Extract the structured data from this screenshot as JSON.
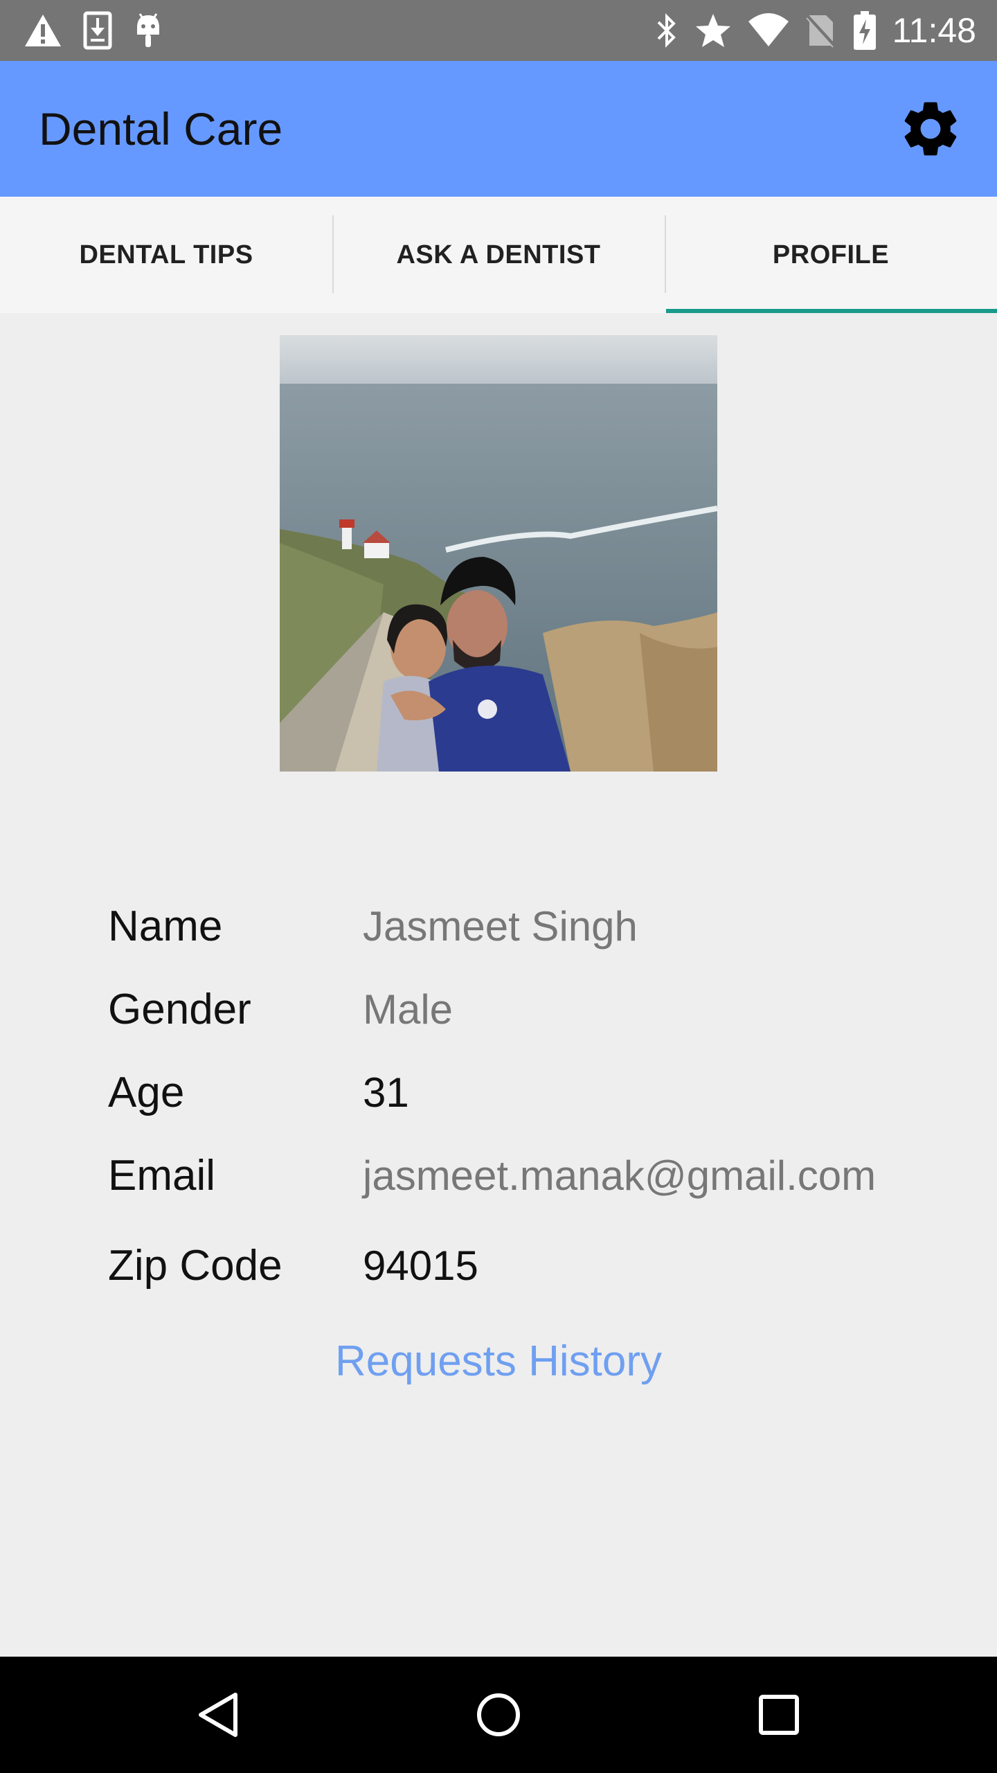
{
  "status_bar": {
    "time": "11:48",
    "icons_left": [
      "warning-icon",
      "download-icon",
      "android-icon"
    ],
    "icons_right": [
      "bluetooth-icon",
      "star-icon",
      "wifi-icon",
      "no-sim-icon",
      "battery-charging-icon"
    ]
  },
  "app_bar": {
    "title": "Dental Care",
    "settings_icon": "gear-icon",
    "color": "#6699ff"
  },
  "tabs": [
    {
      "label": "DENTAL TIPS",
      "active": false
    },
    {
      "label": "ASK A DENTIST",
      "active": false
    },
    {
      "label": "PROFILE",
      "active": true
    }
  ],
  "tab_indicator_color": "#1a9a8a",
  "profile": {
    "fields": [
      {
        "label": "Name",
        "value": "Jasmeet Singh"
      },
      {
        "label": "Gender",
        "value": "Male"
      },
      {
        "label": "Age",
        "value": "31"
      },
      {
        "label": "Email",
        "value": "jasmeet.manak@gmail.com"
      },
      {
        "label": "Zip Code",
        "value": "94015"
      }
    ],
    "history_link": "Requests History",
    "link_color": "#6f9ff0"
  },
  "nav_bar": {
    "buttons": [
      "back-icon",
      "home-icon",
      "recents-icon"
    ]
  }
}
